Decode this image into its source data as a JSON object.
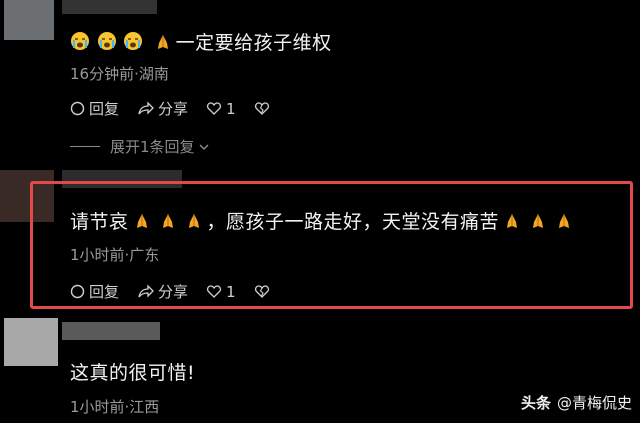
{
  "comments": [
    {
      "text_suffix": "一定要给孩子维权",
      "meta": "16分钟前·湖南",
      "reply_label": "回复",
      "share_label": "分享",
      "like_count": "1"
    },
    {
      "text_prefix": "请节哀",
      "text_middle": "，愿孩子一路走好，天堂没有痛苦",
      "meta": "1小时前·广东",
      "reply_label": "回复",
      "share_label": "分享",
      "like_count": "1"
    },
    {
      "text": "这真的很可惜!",
      "meta": "1小时前·江西"
    }
  ],
  "expand_replies_label": "展开1条回复",
  "watermark": {
    "brand": "头条",
    "handle": "@青梅侃史"
  },
  "colors": {
    "highlight_border": "#e24a4a",
    "background": "#000000"
  }
}
